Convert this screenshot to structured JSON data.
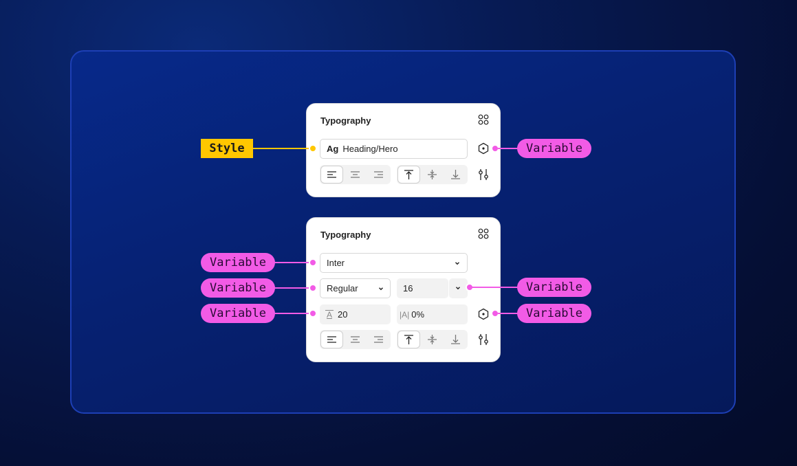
{
  "colors": {
    "style_accent": "#ffc700",
    "variable_accent": "#f25be6",
    "background": "#061e63"
  },
  "panel_top": {
    "title": "Typography",
    "style_prefix": "Ag",
    "style_value": "Heading/Hero",
    "icons": [
      "grid-icon",
      "variable-hexagon-icon",
      "align-left-icon",
      "align-center-icon",
      "align-right-icon",
      "align-top-icon",
      "align-middle-icon",
      "align-bottom-icon",
      "settings-sliders-icon"
    ]
  },
  "panel_bottom": {
    "title": "Typography",
    "font_family": "Inter",
    "font_weight": "Regular",
    "font_size": "16",
    "line_height": "20",
    "letter_spacing": "0%",
    "line_height_glyph": "A",
    "letter_spacing_glyph": "|A|"
  },
  "labels": {
    "style": "Style",
    "variable": "Variable"
  }
}
